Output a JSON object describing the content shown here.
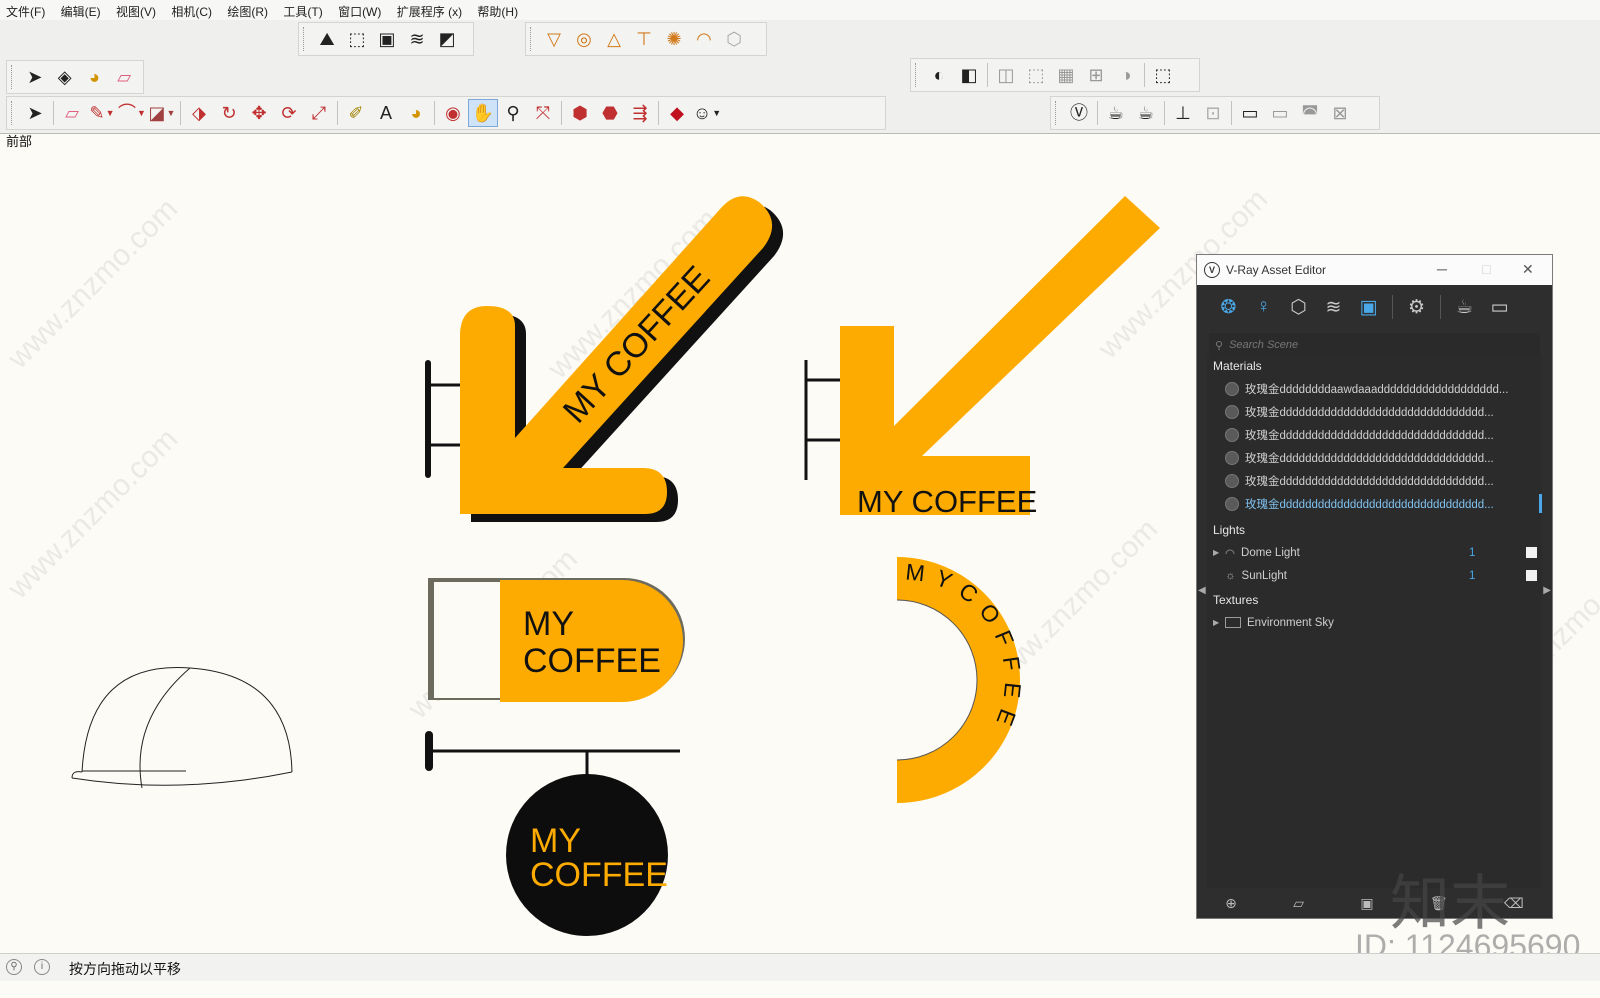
{
  "menu": [
    "文件(F)",
    "编辑(E)",
    "视图(V)",
    "相机(C)",
    "绘图(R)",
    "工具(T)",
    "窗口(W)",
    "扩展程序 (x)",
    "帮助(H)"
  ],
  "view_label": "前部",
  "signs": {
    "sign1_text": "MY COFFEE",
    "sign2_text": "MY COFFEE",
    "sign3_line1": "MY",
    "sign3_line2": "COFFEE",
    "sign4_line1": "MY",
    "sign4_line2": "COFFEE",
    "sign5_text": "M Y C O F F E E"
  },
  "colors": {
    "accent": "#fdab00",
    "dark": "#111111",
    "vray_accent": "#4aa8e8"
  },
  "vray": {
    "title": "V-Ray Asset Editor",
    "search_placeholder": "Search Scene",
    "materials_header": "Materials",
    "materials": [
      "玫瑰金ddddddddaawdaaaddddddddddddddddddd...",
      "玫瑰金dddddddddddddddddddddddddddddddd...",
      "玫瑰金dddddddddddddddddddddddddddddddd...",
      "玫瑰金dddddddddddddddddddddddddddddddd...",
      "玫瑰金dddddddddddddddddddddddddddddddd...",
      "玫瑰金dddddddddddddddddddddddddddddddd..."
    ],
    "lights_header": "Lights",
    "lights": [
      {
        "name": "Dome Light",
        "count": "1"
      },
      {
        "name": "SunLight",
        "count": "1"
      }
    ],
    "textures_header": "Textures",
    "textures": [
      "Environment Sky"
    ]
  },
  "status_text": "按方向拖动以平移",
  "watermark_big": "知末",
  "watermark_id": "ID: 1124695690",
  "watermark_url": "www.znzmo.com"
}
